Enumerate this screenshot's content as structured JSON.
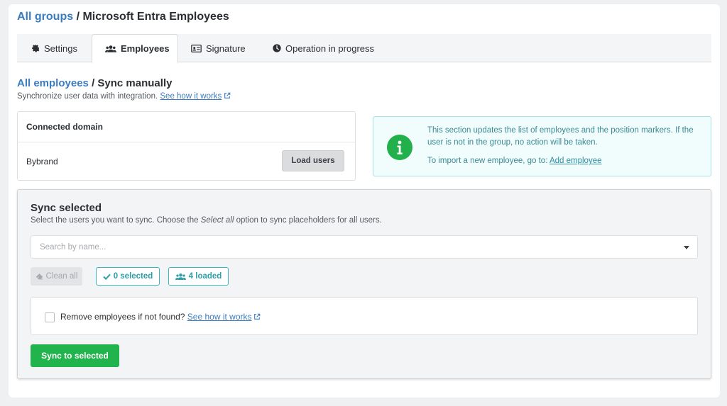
{
  "breadcrumb": {
    "root": "All groups",
    "separator": "/",
    "current": "Microsoft Entra Employees"
  },
  "tabs": [
    {
      "label": "Settings",
      "icon": "gear-icon"
    },
    {
      "label": "Employees",
      "icon": "users-icon",
      "active": true
    },
    {
      "label": "Signature",
      "icon": "id-card-icon"
    },
    {
      "label": "Operation in progress",
      "icon": "clock-icon"
    }
  ],
  "sub_breadcrumb": {
    "root": "All employees",
    "separator": "/",
    "current": "Sync manually"
  },
  "description": {
    "text": "Synchronize user data with integration.",
    "link": "See how it works"
  },
  "domain": {
    "header": "Connected domain",
    "name": "Bybrand",
    "button": "Load users"
  },
  "info": {
    "line1": "This section updates the list of employees and the position markers. If the user is not in the group, no action will be taken.",
    "line2_prefix": "To import a new employee, go to:",
    "line2_link": "Add employee",
    "icon": "info-icon"
  },
  "sync": {
    "title": "Sync selected",
    "desc_before": "Select the users you want to sync. Choose the ",
    "desc_em": "Select all",
    "desc_after": " option to sync placeholders for all users.",
    "search_placeholder": "Search by name...",
    "clean_label": "Clean all",
    "selected_label": "0 selected",
    "loaded_label": "4 loaded",
    "remove_label": "Remove employees if not found?",
    "remove_link": "See how it works",
    "submit_label": "Sync to selected"
  },
  "colors": {
    "accent": "#3a7cc0",
    "teal": "#2c9ea7",
    "green": "#21b34c"
  }
}
